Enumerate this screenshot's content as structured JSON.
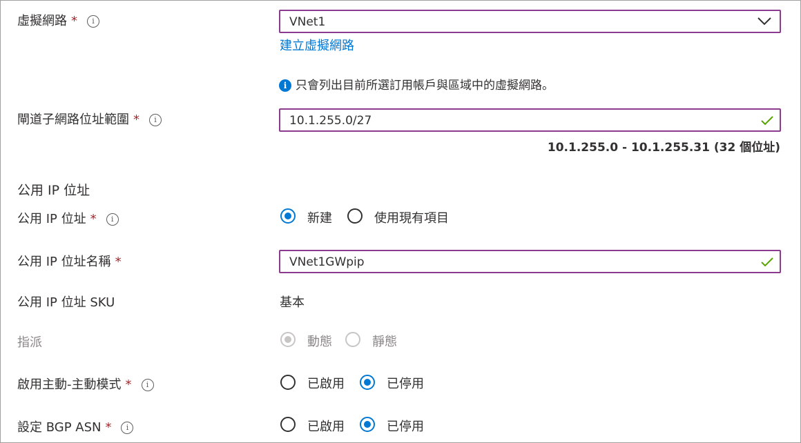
{
  "vnet": {
    "label": "虛擬網路",
    "required": "*",
    "info": "i",
    "value": "VNet1",
    "create_link": "建立虛擬網路",
    "note": "只會列出目前所選訂用帳戶與區域中的虛擬網路。"
  },
  "gateway_subnet": {
    "label": "閘道子網路位址範圍",
    "required": "*",
    "info": "i",
    "value": "10.1.255.0/27",
    "range_text": "10.1.255.0 - 10.1.255.31 (32 個位址)"
  },
  "public_ip_section": {
    "title": "公用 IP 位址"
  },
  "public_ip": {
    "label": "公用 IP 位址",
    "required": "*",
    "info": "i",
    "options": [
      "新建",
      "使用現有項目"
    ],
    "selected": "新建"
  },
  "public_ip_name": {
    "label": "公用 IP 位址名稱",
    "required": "*",
    "value": "VNet1GWpip"
  },
  "public_ip_sku": {
    "label": "公用 IP 位址 SKU",
    "value": "基本"
  },
  "assignment": {
    "label": "指派",
    "options": [
      "動態",
      "靜態"
    ],
    "selected": "動態",
    "disabled": true
  },
  "active_active": {
    "label": "啟用主動-主動模式",
    "required": "*",
    "info": "i",
    "options": [
      "已啟用",
      "已停用"
    ],
    "selected": "已停用"
  },
  "bgp": {
    "label": "設定 BGP ASN",
    "required": "*",
    "info": "i",
    "options": [
      "已啟用",
      "已停用"
    ],
    "selected": "已停用"
  },
  "colors": {
    "accent": "#0078d4",
    "field_border": "#8a3b8f",
    "required": "#a4262c",
    "valid_check": "#57a300"
  },
  "icons": [
    "info-icon",
    "chevron-down-icon",
    "check-icon",
    "info-filled-icon"
  ]
}
